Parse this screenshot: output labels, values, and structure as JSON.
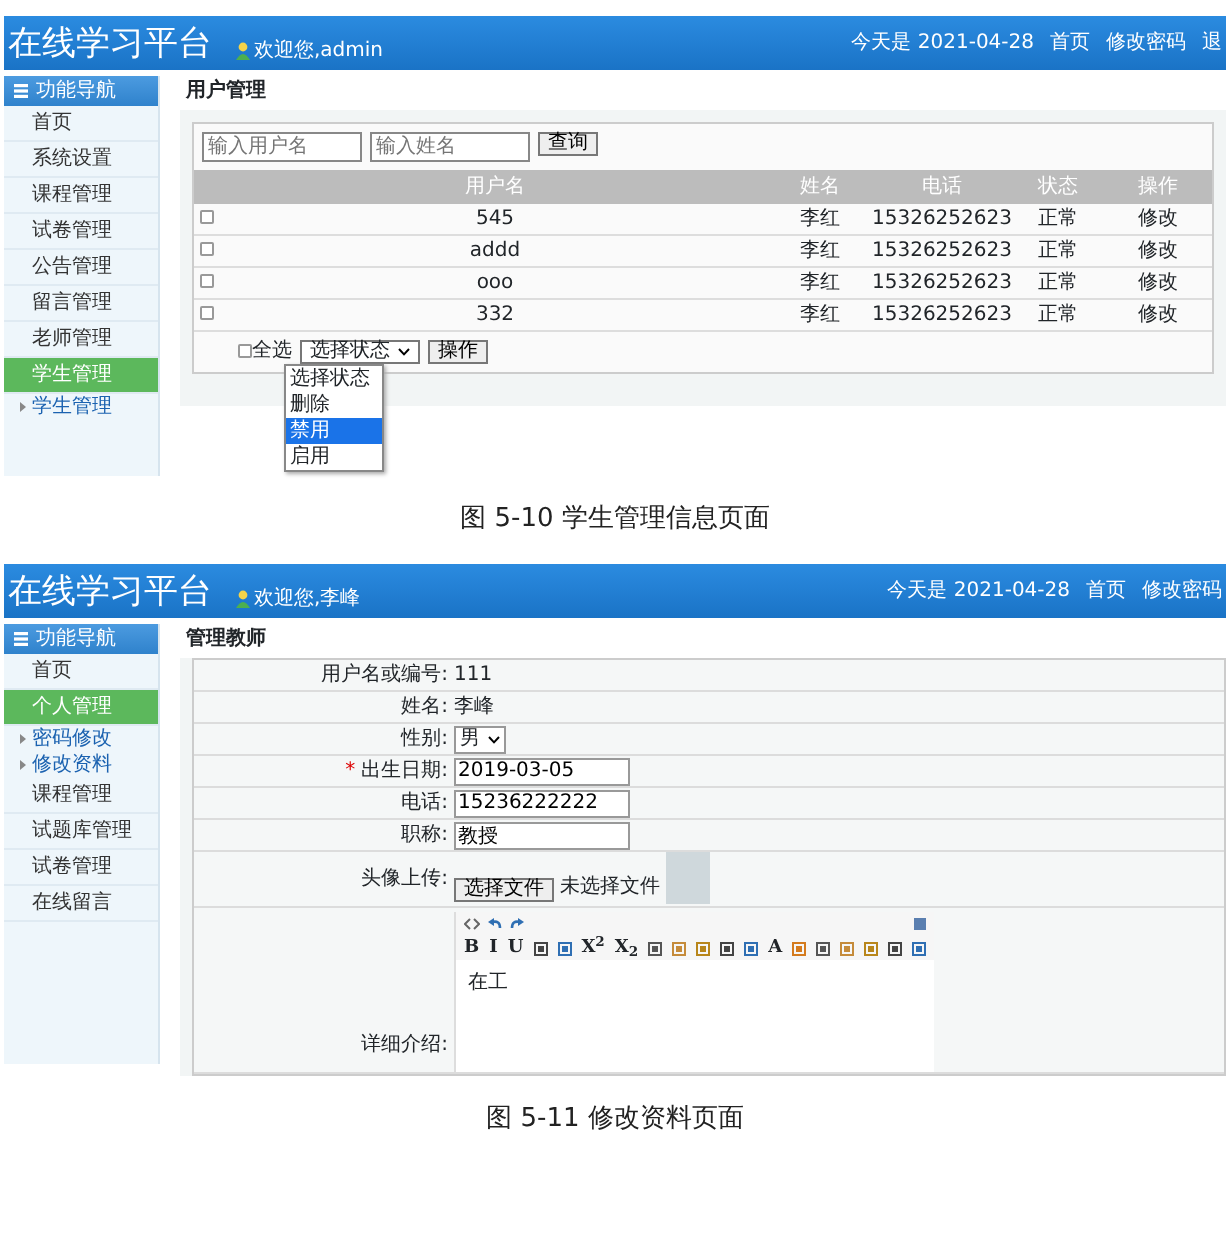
{
  "figure_1": {
    "header": {
      "title": "在线学习平台",
      "welcome": "欢迎您,admin",
      "date": "今天是 2021-04-28",
      "links": [
        "首页",
        "修改密码",
        "退"
      ]
    },
    "sidebar": {
      "heading": "功能导航",
      "items": [
        {
          "kind": "item",
          "label": "首页",
          "selected": false
        },
        {
          "kind": "item",
          "label": "系统设置",
          "selected": false
        },
        {
          "kind": "item",
          "label": "课程管理",
          "selected": false
        },
        {
          "kind": "item",
          "label": "试卷管理",
          "selected": false
        },
        {
          "kind": "item",
          "label": "公告管理",
          "selected": false
        },
        {
          "kind": "item",
          "label": "留言管理",
          "selected": false
        },
        {
          "kind": "item",
          "label": "老师管理",
          "selected": false
        },
        {
          "kind": "item",
          "label": "学生管理",
          "selected": true
        },
        {
          "kind": "sub",
          "label": "学生管理",
          "selected": false
        }
      ]
    },
    "page_title": "用户管理",
    "search": {
      "fields": [
        {
          "placeholder": "输入用户名"
        },
        {
          "placeholder": "输入姓名"
        }
      ],
      "button": "查询"
    },
    "table": {
      "columns": [
        "用户名",
        "姓名",
        "电话",
        "状态",
        "操作"
      ],
      "rows": [
        {
          "checked": false,
          "cells": [
            "545",
            "李红",
            "15326252623",
            "正常",
            "修改"
          ]
        },
        {
          "checked": false,
          "cells": [
            "addd",
            "李红",
            "15326252623",
            "正常",
            "修改"
          ]
        },
        {
          "checked": false,
          "cells": [
            "ooo",
            "李红",
            "15326252623",
            "正常",
            "修改"
          ]
        },
        {
          "checked": false,
          "cells": [
            "332",
            "李红",
            "15326252623",
            "正常",
            "修改"
          ]
        }
      ]
    },
    "footer": {
      "select_all": {
        "label": "全选",
        "checked": false
      },
      "select": {
        "value": "选择状态"
      },
      "options": [
        {
          "label": "选择状态",
          "selected": false
        },
        {
          "label": "删除",
          "selected": false
        },
        {
          "label": "禁用",
          "selected": true
        },
        {
          "label": "启用",
          "selected": false
        }
      ],
      "action_button": "操作"
    },
    "caption": "图 5-10 学生管理信息页面"
  },
  "figure_2": {
    "header": {
      "title": "在线学习平台",
      "welcome": "欢迎您,李峰",
      "date": "今天是 2021-04-28",
      "links": [
        "首页",
        "修改密码"
      ]
    },
    "sidebar": {
      "heading": "功能导航",
      "items": [
        {
          "kind": "item",
          "label": "首页",
          "selected": false
        },
        {
          "kind": "item",
          "label": "个人管理",
          "selected": true
        },
        {
          "kind": "sub",
          "label": "密码修改",
          "selected": false
        },
        {
          "kind": "sub",
          "label": "修改资料",
          "selected": false
        },
        {
          "kind": "item",
          "label": "课程管理",
          "selected": false
        },
        {
          "kind": "item",
          "label": "试题库管理",
          "selected": false
        },
        {
          "kind": "item",
          "label": "试卷管理",
          "selected": false
        },
        {
          "kind": "item",
          "label": "在线留言",
          "selected": false
        }
      ]
    },
    "page_title": "管理教师",
    "form": [
      {
        "kind": "text",
        "label": "用户名或编号:",
        "value": "111"
      },
      {
        "kind": "text",
        "label": "姓名:",
        "value": "李峰"
      },
      {
        "kind": "select",
        "label": "性别:",
        "value": "男"
      },
      {
        "kind": "input",
        "label": "出生日期:",
        "required_mark": "*",
        "value": "2019-03-05"
      },
      {
        "kind": "input",
        "label": "电话:",
        "value": "15236222222"
      },
      {
        "kind": "input",
        "label": "职称:",
        "value": "教授"
      },
      {
        "kind": "file",
        "label": "头像上传:",
        "button": "选择文件",
        "status": "未选择文件"
      },
      {
        "kind": "editor",
        "label": "详细介绍:",
        "toolbar": [
          {
            "kind": "text",
            "label": "B"
          },
          {
            "kind": "text",
            "label": "I"
          },
          {
            "kind": "text",
            "label": "U"
          },
          {
            "kind": "icon"
          },
          {
            "kind": "icon"
          },
          {
            "kind": "text",
            "label": "X$^{2}$"
          },
          {
            "kind": "text",
            "label": "X$_{2}$"
          },
          {
            "kind": "icon"
          },
          {
            "kind": "icon"
          },
          {
            "kind": "icon"
          },
          {
            "kind": "icon"
          },
          {
            "kind": "icon"
          },
          {
            "kind": "text",
            "label": "A"
          },
          {
            "kind": "icon"
          },
          {
            "kind": "icon"
          },
          {
            "kind": "icon"
          },
          {
            "kind": "icon"
          },
          {
            "kind": "icon"
          },
          {
            "kind": "icon"
          }
        ],
        "value": "在工"
      }
    ],
    "caption": "图 5-11 修改资料页面"
  }
}
